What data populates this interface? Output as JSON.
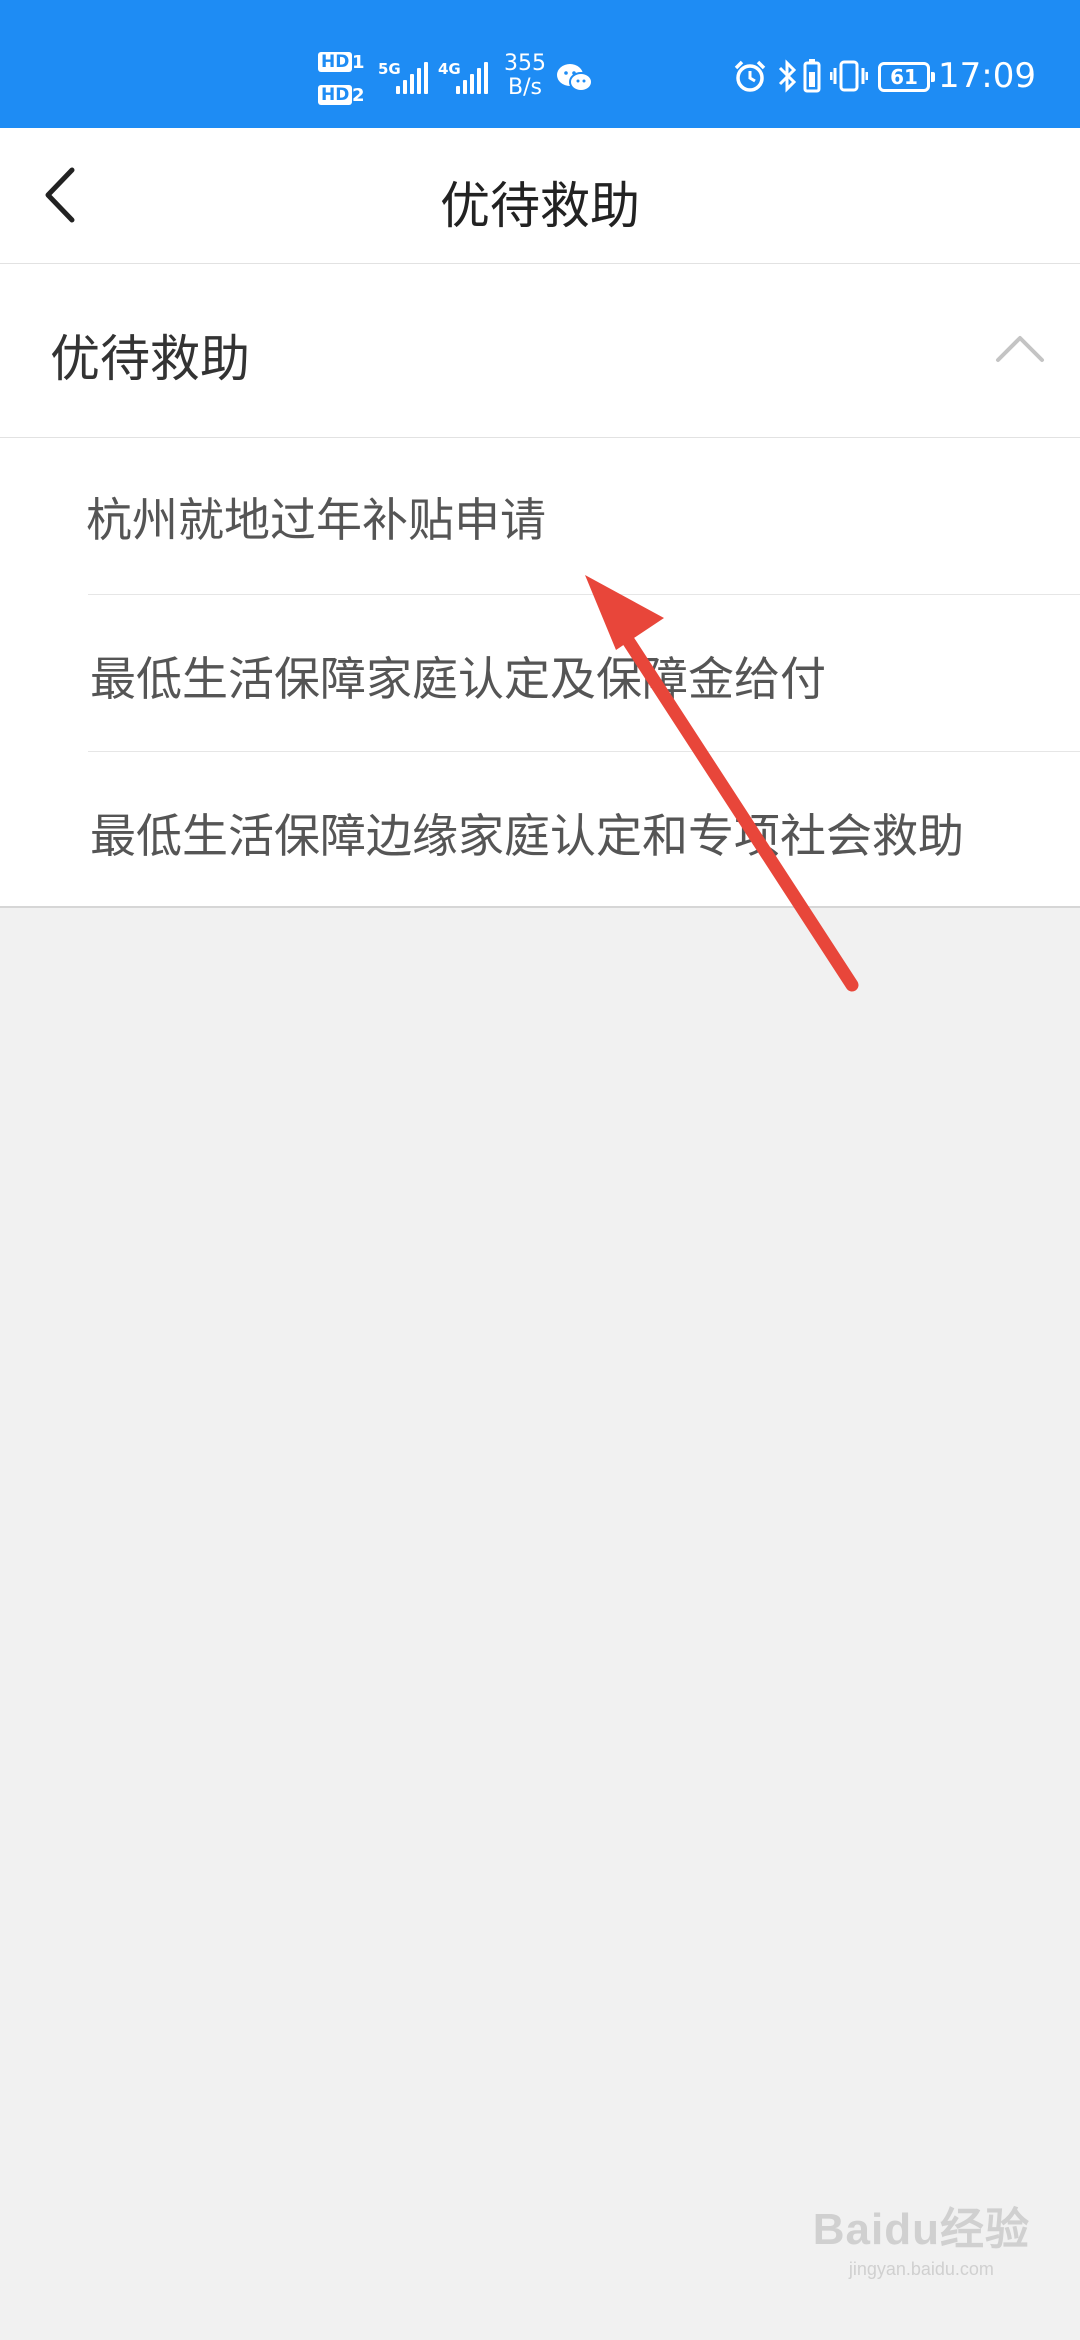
{
  "status_bar": {
    "sim1_badge": "HD",
    "sim1_num": "1",
    "sim2_badge": "HD",
    "sim2_num": "2",
    "network1": "5G",
    "network2": "4G",
    "speed_value": "355",
    "speed_unit": "B/s",
    "battery": "61",
    "time": "17:09",
    "icons": [
      "wechat-icon",
      "alarm-icon",
      "bluetooth-icon",
      "battery-saver-icon",
      "vibrate-icon"
    ]
  },
  "nav": {
    "title": "优待救助"
  },
  "section": {
    "title": "优待救助",
    "expanded": true
  },
  "items": [
    {
      "label": "杭州就地过年补贴申请"
    },
    {
      "label": "最低生活保障家庭认定及保障金给付"
    },
    {
      "label": "最低生活保障边缘家庭认定和专项社会救助"
    }
  ],
  "annotation": {
    "arrow_color": "#e8463a"
  },
  "watermark": {
    "logo": "Baidu经验",
    "url": "jingyan.baidu.com"
  }
}
